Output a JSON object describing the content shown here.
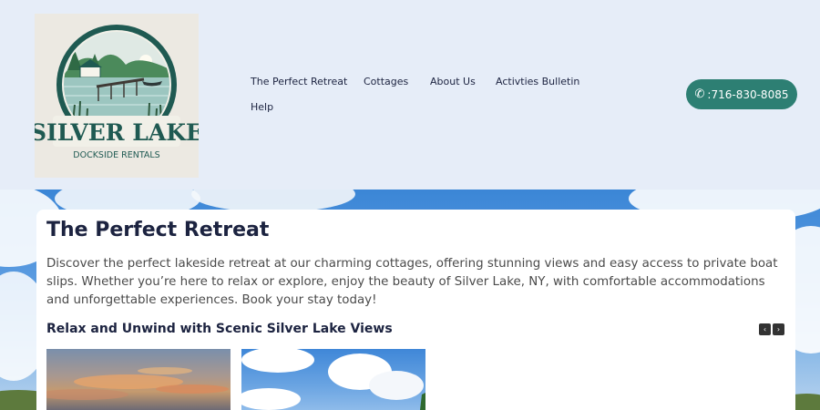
{
  "header": {
    "logo": {
      "icon": "silver-lake-logo",
      "name": "SILVER LAKE",
      "tagline": "DOCKSIDE RENTALS"
    },
    "nav": [
      {
        "label": "The Perfect Retreat"
      },
      {
        "label": "Cottages"
      },
      {
        "label": "About Us"
      },
      {
        "label": "Activties Bulletin"
      },
      {
        "label": "Help"
      }
    ],
    "phone": {
      "icon": "phone-icon",
      "label": ":716-830-8085",
      "color": "#2d7f73"
    }
  },
  "main": {
    "title": "The Perfect Retreat",
    "description": "Discover the perfect lakeside retreat at our charming cottages, offering stunning views and easy access to private boat slips. Whether you’re here to relax or explore, enjoy the beauty of Silver Lake, NY, with comfortable accommodations and unforgettable experiences. Book your stay today!",
    "gallery": {
      "title": "Relax and Unwind with Scenic Silver Lake Views",
      "prev_icon": "chevron-left-icon",
      "next_icon": "chevron-right-icon",
      "prev_label": "‹",
      "next_label": "›"
    }
  },
  "colors": {
    "header_bg": "#e6edf8",
    "title_text": "#1c2340",
    "accent": "#2d7f73"
  }
}
